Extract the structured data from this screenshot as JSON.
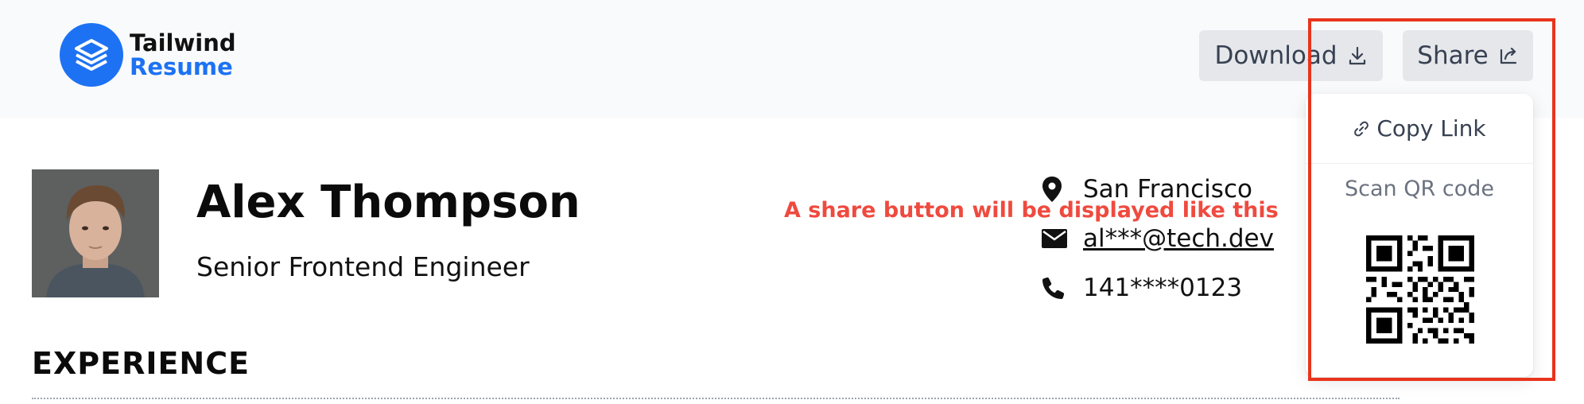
{
  "header": {
    "logo": {
      "line1": "Tailwind",
      "line2": "Resume",
      "icon": "stacked-layers-icon"
    },
    "download_button": {
      "label": "Download",
      "icon": "download-icon"
    },
    "share_button": {
      "label": "Share",
      "icon": "share-icon"
    }
  },
  "share_menu": {
    "copy_link": {
      "label": "Copy Link",
      "icon": "link-icon"
    },
    "scan_label": "Scan QR code",
    "qr_icon": "qr-code-icon"
  },
  "annotation": "A share button will be displayed like this",
  "profile": {
    "name": "Alex Thompson",
    "title": "Senior Frontend Engineer",
    "avatar": "profile-photo"
  },
  "contact": {
    "location": {
      "text": "San Francisco",
      "icon": "map-pin-icon"
    },
    "email": {
      "text": "al***@tech.dev",
      "icon": "envelope-icon"
    },
    "phone": {
      "text": "141****0123",
      "icon": "phone-icon"
    }
  },
  "sections": {
    "experience": "EXPERIENCE"
  },
  "colors": {
    "brand_blue": "#1d72f3",
    "header_bg": "#f9fafb",
    "button_bg": "#e5e7eb",
    "annotation_red": "#ef4a3f",
    "highlight_red": "#e8341c"
  }
}
